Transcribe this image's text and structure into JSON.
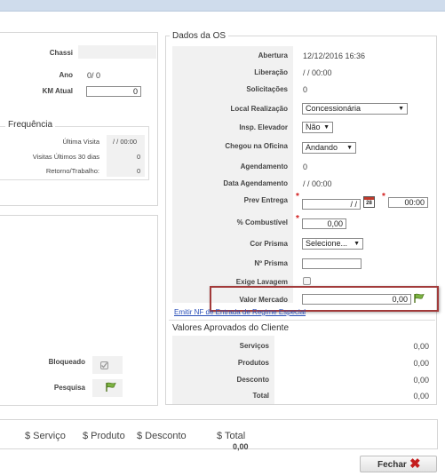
{
  "left": {
    "chassi_label": "Chassi",
    "ano_label": "Ano",
    "ano_value": "0/ 0",
    "km_label": "KM Atual",
    "km_value": "0"
  },
  "frequencia": {
    "title": "Frequência",
    "rows": [
      {
        "label": "Última Visita",
        "value": "/ / 00:00"
      },
      {
        "label": "Visitas Últimos 30 dias",
        "value": "0"
      },
      {
        "label": "Retorno/Trabalho:",
        "value": "0"
      }
    ]
  },
  "bloqueado": {
    "bloqueado_label": "Bloqueado",
    "pesquisa_label": "Pesquisa"
  },
  "dados_os": {
    "title": "Dados da OS",
    "abertura_label": "Abertura",
    "abertura_value": "12/12/2016 16:36",
    "liberacao_label": "Liberação",
    "liberacao_value": "/ / 00:00",
    "solicitacoes_label": "Solicitações",
    "solicitacoes_value": "0",
    "local_label": "Local Realização",
    "local_value": "Concessionária",
    "insp_label": "Insp. Elevador",
    "insp_value": "Não",
    "chegou_label": "Chegou na Oficina",
    "chegou_value": "Andando",
    "agendamento_label": "Agendamento",
    "agendamento_value": "0",
    "data_agendamento_label": "Data Agendamento",
    "data_agendamento_value": "/ / 00:00",
    "prev_label": "Prev Entrega",
    "prev_date_value": "/ /",
    "prev_time_value": "00:00",
    "calendar_day": "28",
    "combustivel_label": "% Combustível",
    "combustivel_value": "0,00",
    "cor_label": "Cor Prisma",
    "cor_value": "Selecione...",
    "nprisma_label": "Nº Prisma",
    "nprisma_value": "",
    "lavagem_label": "Exige Lavagem",
    "valor_label": "Valor Mercado",
    "valor_value": "0,00",
    "link_text": "Emitir NF de Entrada de Regime Especial"
  },
  "valores": {
    "title": "Valores Aprovados do Cliente",
    "rows": [
      {
        "label": "Serviços",
        "value": "0,00"
      },
      {
        "label": "Produtos",
        "value": "0,00"
      },
      {
        "label": "Desconto",
        "value": "0,00"
      },
      {
        "label": "Total",
        "value": "0,00"
      }
    ]
  },
  "summary": {
    "col_servico": "$ Serviço",
    "col_produto": "$ Produto",
    "col_desconto": "$ Desconto",
    "col_total": "$ Total",
    "total_value": "0,00"
  },
  "footer": {
    "fechar_label": "Fechar"
  },
  "colors": {
    "accent_red": "#a23a3a",
    "link_blue": "#2a4fb8",
    "topbar": "#cfdcec"
  }
}
